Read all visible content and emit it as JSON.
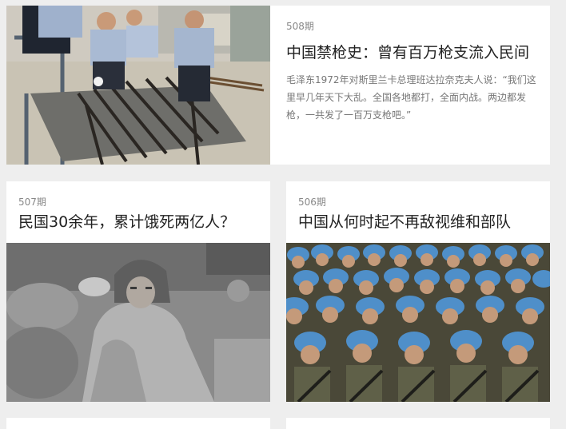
{
  "articles": [
    {
      "issue": "508期",
      "title": "中国禁枪史：曾有百万枪支流入民间",
      "summary": "毛泽东1972年对斯里兰卡总理班达拉奈克夫人说：“我们这里早几年天下大乱。全国各地都打，全面内战。两边都发枪，一共发了一百万支枪吧。”",
      "image": "police-officers-with-confiscated-guns-photo"
    },
    {
      "issue": "507期",
      "title": "民国30余年，累计饿死两亿人？",
      "image": "black-and-white-child-in-padded-coat-photo"
    },
    {
      "issue": "506期",
      "title": "中国从何时起不再敌视维和部队",
      "image": "peacekeepers-in-blue-helmets-photo"
    }
  ]
}
